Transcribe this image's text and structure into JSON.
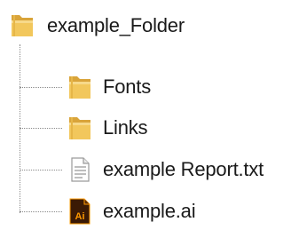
{
  "tree": {
    "root": {
      "label": "example_Folder",
      "icon": "folder-icon"
    },
    "children": [
      {
        "label": "Fonts",
        "icon": "folder-icon"
      },
      {
        "label": "Links",
        "icon": "folder-icon"
      },
      {
        "label": "example Report.txt",
        "icon": "text-file-icon"
      },
      {
        "label": "example.ai",
        "icon": "illustrator-file-icon",
        "badge": "Ai"
      }
    ]
  },
  "colors": {
    "folder_back": "#d9a43a",
    "folder_front": "#f2c75c",
    "ai_file": "#3b1a05",
    "ai_accent": "#ff9a00",
    "connector": "#8a8a8a"
  }
}
